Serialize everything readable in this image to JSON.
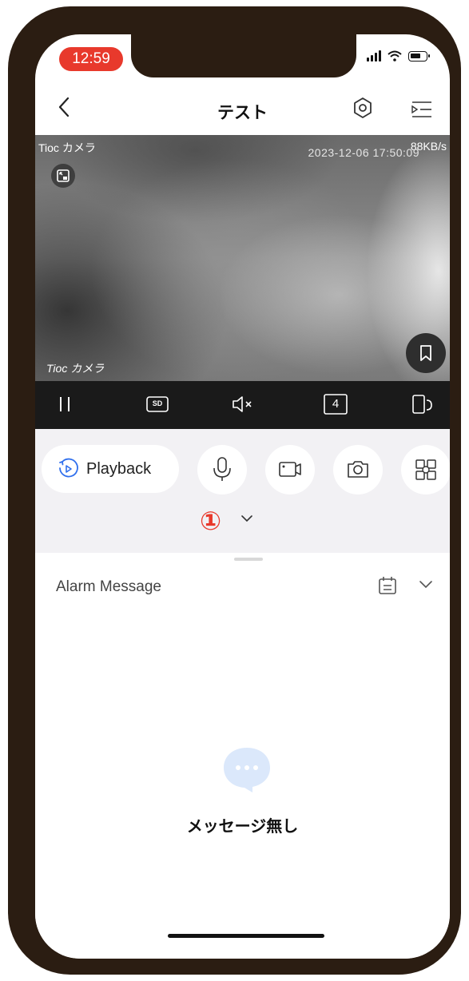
{
  "status_bar": {
    "time": "12:59"
  },
  "header": {
    "title": "テスト",
    "back_icon": "chevron-left-icon",
    "settings_icon": "hexagon-settings-icon",
    "more_icon": "menu-list-icon"
  },
  "video": {
    "camera_name_top": "Tioc カメラ",
    "data_rate": "88KB/s",
    "timestamp": "2023-12-06 17:50:09",
    "camera_name_bottom": "Tioc カメラ"
  },
  "control_bar": {
    "quality_label": "SD",
    "split_label": "4"
  },
  "actions": {
    "playback_label": "Playback",
    "annotation_marker": "①"
  },
  "alarm": {
    "title": "Alarm Message",
    "empty_text": "メッセージ無し"
  },
  "colors": {
    "accent_red": "#e8392c",
    "accent_blue": "#2f6fed",
    "empty_icon_blue": "#dbe8fb"
  }
}
